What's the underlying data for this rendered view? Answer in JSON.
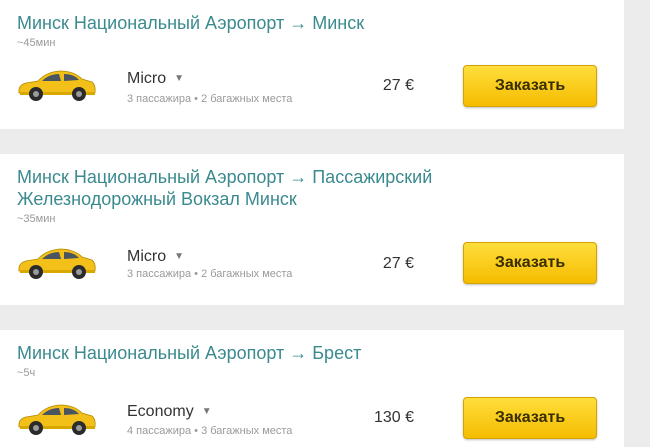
{
  "routes": [
    {
      "route_line1": "Минск Национальный Аэропорт → Минск",
      "route_line2": "",
      "duration": "~45мин",
      "car_icon": "yellow-taxi-hatchback-icon",
      "class_name": "Micro",
      "capacity": "3 пассажира • 2 багажных места",
      "price": "27 €",
      "order_label": "Заказать"
    },
    {
      "route_line1": "Минск Национальный Аэропорт → Пассажирский",
      "route_line2": "Железнодорожный Вокзал Минск",
      "duration": "~35мин",
      "car_icon": "yellow-taxi-hatchback-icon",
      "class_name": "Micro",
      "capacity": "3 пассажира • 2 багажных места",
      "price": "27 €",
      "order_label": "Заказать"
    },
    {
      "route_line1": "Минск Национальный Аэропорт → Брест",
      "route_line2": "",
      "duration": "~5ч",
      "car_icon": "yellow-taxi-hatchback-icon",
      "class_name": "Economy",
      "capacity": "4 пассажира • 3 багажных места",
      "price": "130 €",
      "order_label": "Заказать"
    }
  ],
  "colors": {
    "route_text": "#3a8a8f",
    "button_yellow": "#ffd21f",
    "page_background": "#ececec"
  },
  "icons": {
    "class_dropdown": "caret-down-icon"
  }
}
